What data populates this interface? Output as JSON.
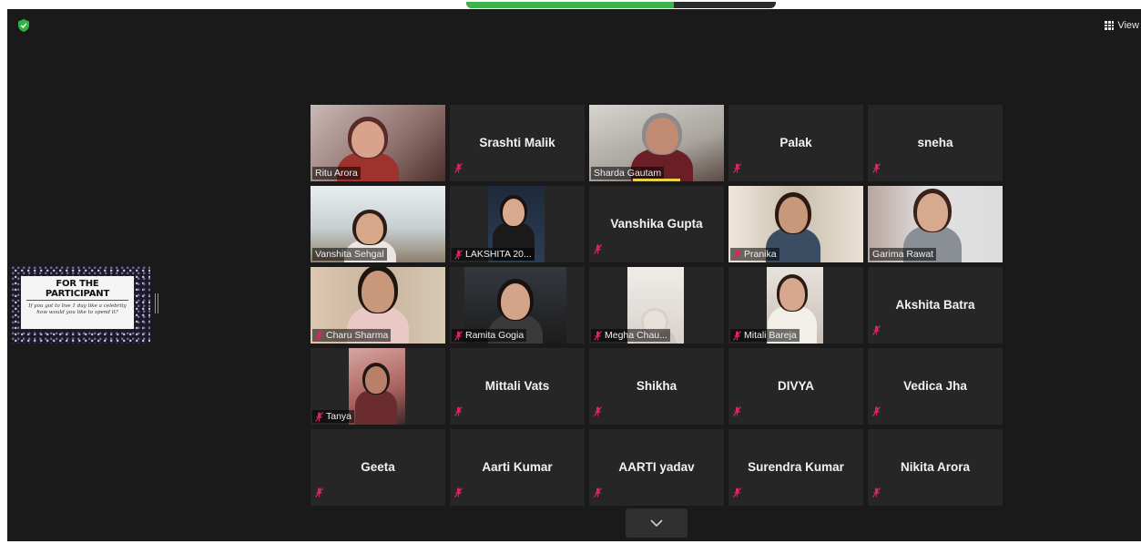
{
  "header": {
    "view_label": "View",
    "icons": [
      "shield-icon",
      "grid-view-icon"
    ]
  },
  "share_screen": {
    "title": "FOR THE PARTICIPANT",
    "body": "If you got to live 1 day like a celebrity how would you like to spend it?"
  },
  "participants": [
    {
      "name": "Ritu Arora",
      "video": true,
      "muted": false
    },
    {
      "name": "Srashti Malik",
      "video": false,
      "muted": true
    },
    {
      "name": "Sharda Gautam",
      "video": true,
      "muted": false,
      "speaking": true
    },
    {
      "name": "Palak",
      "video": false,
      "muted": true
    },
    {
      "name": "sneha",
      "video": false,
      "muted": true
    },
    {
      "name": "Vanshita Sehgal",
      "video": true,
      "muted": false
    },
    {
      "name": "LAKSHITA 20...",
      "video": true,
      "muted": true
    },
    {
      "name": "Vanshika Gupta",
      "video": false,
      "muted": true
    },
    {
      "name": "Pranika",
      "video": true,
      "muted": true
    },
    {
      "name": "Garima Rawat",
      "video": true,
      "muted": false,
      "active": true
    },
    {
      "name": "Charu Sharma",
      "video": true,
      "muted": true
    },
    {
      "name": "Ramita Gogia",
      "video": true,
      "muted": true
    },
    {
      "name": "Megha Chau...",
      "video": true,
      "muted": true
    },
    {
      "name": "Mitali Bareja",
      "video": true,
      "muted": true
    },
    {
      "name": "Akshita Batra",
      "video": false,
      "muted": true
    },
    {
      "name": "Tanya",
      "video": true,
      "muted": true
    },
    {
      "name": "Mittali Vats",
      "video": false,
      "muted": true
    },
    {
      "name": "Shikha",
      "video": false,
      "muted": true
    },
    {
      "name": "DIVYA",
      "video": false,
      "muted": true
    },
    {
      "name": "Vedica Jha",
      "video": false,
      "muted": true
    },
    {
      "name": "Geeta",
      "video": false,
      "muted": true
    },
    {
      "name": "Aarti Kumar",
      "video": false,
      "muted": true
    },
    {
      "name": "AARTI yadav",
      "video": false,
      "muted": true
    },
    {
      "name": "Surendra Kumar",
      "video": false,
      "muted": true
    },
    {
      "name": "Nikita Arora",
      "video": false,
      "muted": true
    }
  ],
  "colors": {
    "background": "#1a1a1a",
    "tile": "#262626",
    "active_border": "#d7e48a",
    "muted_mic": "#e0245e",
    "speaking": "#e7d34a",
    "secure": "#2fb344"
  }
}
